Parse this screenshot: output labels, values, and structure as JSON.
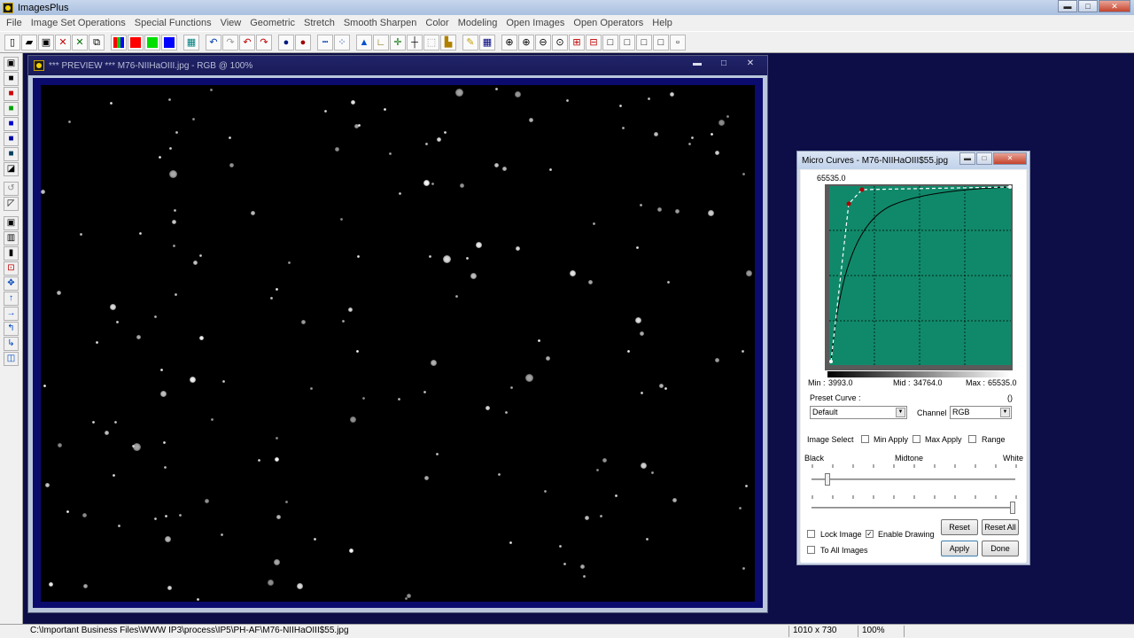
{
  "app": {
    "title": "ImagesPlus"
  },
  "menu": [
    "File",
    "Image Set Operations",
    "Special Functions",
    "View",
    "Geometric",
    "Stretch",
    "Smooth Sharpen",
    "Color",
    "Modeling",
    "Open Images",
    "Open Operators",
    "Help"
  ],
  "toolbar": {
    "icons": [
      "new-file-icon",
      "open-folder-icon",
      "save-icon",
      "close-icon",
      "exit-icon",
      "copy-window-icon",
      "rgb-channels-icon",
      "red-channel-icon",
      "green-channel-icon",
      "blue-channel-icon",
      "grid-icon",
      "undo-icon",
      "redo-icon",
      "undo-all-icon",
      "redo-all-icon",
      "record-icon",
      "stop-record-icon",
      "line-icon",
      "pixel-info-icon",
      "triangle-icon",
      "angle-icon",
      "crosshair-icon",
      "cross-icon",
      "select-icon",
      "folder-image-icon",
      "pencil-icon",
      "table-icon",
      "zoom-icon",
      "zoom-in-icon",
      "zoom-out-icon",
      "zoom-fit-icon",
      "zoom-plus-icon",
      "zoom-minus-icon",
      "rect-1-icon",
      "rect-2-icon",
      "rect-3-icon",
      "rect-4-icon",
      "rect-5-icon"
    ],
    "colors": {
      "red": "#ff0000",
      "green": "#00e000",
      "blue": "#0000ff"
    }
  },
  "left_toolbar": {
    "icons": [
      "save-icon",
      "black-square-icon",
      "red-swatch-icon",
      "green-swatch-icon",
      "blue-swatch-icon",
      "blue-black-icon",
      "dark-swatch-icon",
      "shadow-icon",
      "rotate-icon",
      "diagonal-icon",
      "frame-icon",
      "bars-icon",
      "black-bar-icon",
      "crop-icon",
      "move-icon",
      "up-arrow-icon",
      "right-arrow-icon",
      "rotate-left-icon",
      "rotate-right-icon",
      "info-icon"
    ]
  },
  "preview": {
    "title": "*** PREVIEW *** M76-NIIHaOIII.jpg - RGB @ 100%",
    "controls": {
      "minimize": "▬",
      "maximize": "□",
      "close": "✕"
    }
  },
  "curves_dialog": {
    "title": "Micro Curves - M76-NIIHaOIII$55.jpg",
    "top_value": "65535.0",
    "min_label": "Min :",
    "min_value": "3993.0",
    "mid_label": "Mid :",
    "mid_value": "34764.0",
    "max_label": "Max :",
    "max_value": "65535.0",
    "coords": "()",
    "preset_label": "Preset Curve :",
    "preset_value": "Default",
    "channel_label": "Channel",
    "channel_value": "RGB",
    "image_select_label": "Image Select",
    "min_apply_label": "Min Apply",
    "min_apply_checked": false,
    "max_apply_label": "Max Apply",
    "max_apply_checked": false,
    "range_label": "Range",
    "range_checked": false,
    "black_label": "Black",
    "midtone_label": "Midtone",
    "white_label": "White",
    "lock_image_label": "Lock Image",
    "lock_image_checked": false,
    "enable_drawing_label": "Enable Drawing",
    "enable_drawing_checked": true,
    "to_all_images_label": "To All Images",
    "to_all_images_checked": false,
    "reset_label": "Reset",
    "reset_all_label": "Reset All",
    "apply_label": "Apply",
    "done_label": "Done",
    "graph_bg_color": "#10896a",
    "control_point_color": "#b00000"
  },
  "status": {
    "path": "C:\\Important Business Files\\WWW IP3\\process\\IP5\\PH-AF\\M76-NIIHaOIII$55.jpg",
    "dimensions": "1010 x 730",
    "zoom": "100%"
  }
}
